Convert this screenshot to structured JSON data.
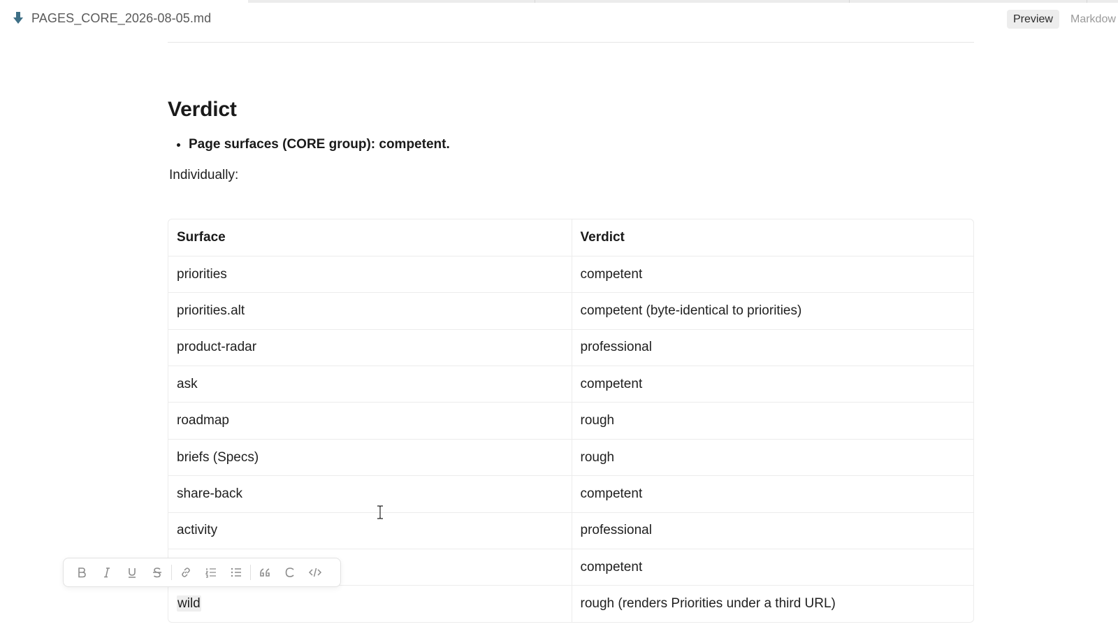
{
  "header": {
    "file_name": "PAGES_CORE_2026-08-05.md",
    "modes": {
      "preview": "Preview",
      "markdown": "Markdow"
    }
  },
  "document": {
    "heading": "Verdict",
    "bullets": [
      "Page surfaces (CORE group): competent."
    ],
    "intro": "Individually:",
    "table": {
      "headers": [
        "Surface",
        "Verdict"
      ],
      "rows": [
        [
          "priorities",
          "competent"
        ],
        [
          "priorities.alt",
          "competent (byte-identical to priorities)"
        ],
        [
          "product-radar",
          "professional"
        ],
        [
          "ask",
          "competent"
        ],
        [
          "roadmap",
          "rough"
        ],
        [
          "briefs (Specs)",
          "rough"
        ],
        [
          "share-back",
          "competent"
        ],
        [
          "activity",
          "professional"
        ],
        [
          "",
          "competent"
        ],
        [
          "wild",
          "rough (renders Priorities under a third URL)"
        ]
      ]
    }
  },
  "toolbar": {
    "buttons": [
      "bold-icon",
      "italic-icon",
      "underline-icon",
      "strikethrough-icon",
      "link-icon",
      "ordered-list-icon",
      "bullet-list-icon",
      "quote-icon",
      "refresh-icon",
      "code-icon"
    ]
  }
}
